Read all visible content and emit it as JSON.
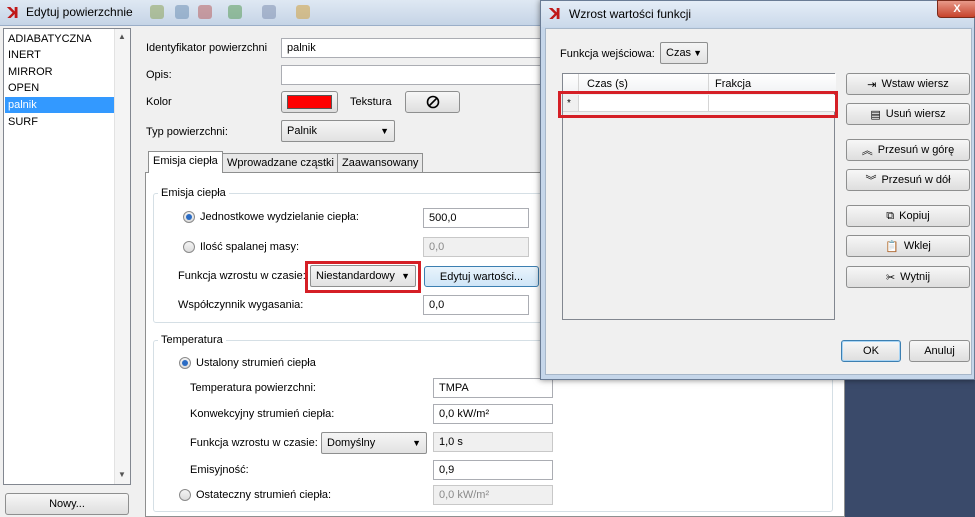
{
  "main": {
    "title": "Edytuj powierzchnie",
    "surfaces": [
      "ADIABATYCZNA",
      "INERT",
      "MIRROR",
      "OPEN",
      "palnik",
      "SURF"
    ],
    "selected_surface": "palnik",
    "new_button": "Nowy...",
    "fields": {
      "id_label": "Identyfikator powierzchni",
      "id_value": "palnik",
      "desc_label": "Opis:",
      "desc_value": "",
      "color_label": "Kolor",
      "color_value": "#ff0000",
      "texture_label": "Tekstura",
      "type_label": "Typ powierzchni:",
      "type_value": "Palnik"
    },
    "tabs": [
      "Emisja ciepła",
      "Wprowadzane cząstki",
      "Zaawansowany"
    ],
    "heat": {
      "group_title": "Emisja ciepła",
      "unit_heat_label": "Jednostkowe wydzielanie ciepła:",
      "unit_heat_value": "500,0",
      "mass_label": "Ilość spalanej masy:",
      "mass_value": "0,0",
      "ramp_label": "Funkcja wzrostu w czasie:",
      "ramp_value": "Niestandardowy",
      "edit_button": "Edytuj wartości...",
      "extinction_label": "Współczynnik wygasania:",
      "extinction_value": "0,0"
    },
    "temperature": {
      "group_title": "Temperatura",
      "fixed_flux_label": "Ustalony strumień ciepła",
      "surface_temp_label": "Temperatura powierzchni:",
      "surface_temp_value": "TMPA",
      "convective_label": "Konwekcyjny strumień ciepła:",
      "convective_value": "0,0 kW/m²",
      "ramp_label": "Funkcja wzrostu w czasie:",
      "ramp_value": "Domyślny",
      "ramp_time": "1,0 s",
      "emissivity_label": "Emisyjność:",
      "emissivity_value": "0,9",
      "net_flux_label": "Ostateczny strumień ciepła:",
      "net_flux_value": "0,0 kW/m²"
    }
  },
  "dialog": {
    "title": "Wzrost wartości funkcji",
    "close_glyph": "X",
    "input_fn_label": "Funkcja wejściowa:",
    "input_fn_value": "Czas",
    "columns": [
      "Czas (s)",
      "Frakcja"
    ],
    "new_row_marker": "*",
    "buttons": {
      "insert_row": "Wstaw wiersz",
      "delete_row": "Usuń wiersz",
      "move_up": "Przesuń w górę",
      "move_down": "Przesuń w dół",
      "copy": "Kopiuj",
      "paste": "Wklej",
      "cut": "Wytnij",
      "ok": "OK",
      "cancel": "Anuluj"
    }
  }
}
